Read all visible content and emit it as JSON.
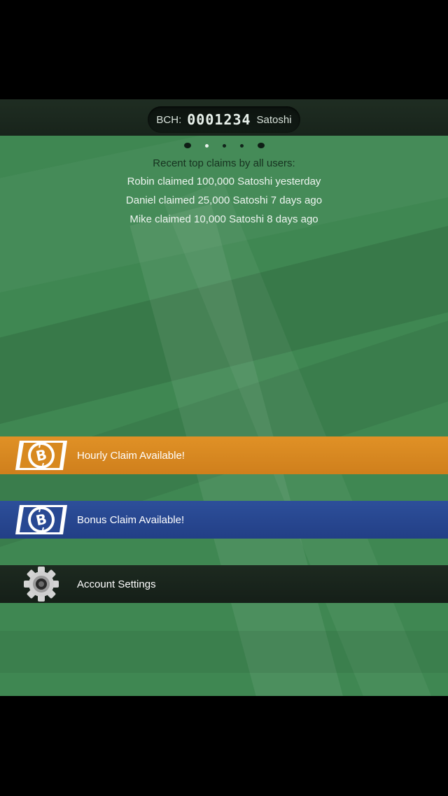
{
  "balance": {
    "label": "BCH:",
    "digits": "0001234",
    "unit": "Satoshi"
  },
  "pager": {
    "count": 5,
    "active_index": 1
  },
  "recent_claims": {
    "title": "Recent top claims by all users:",
    "items": [
      "Robin claimed 100,000 Satoshi yesterday",
      "Daniel claimed 25,000 Satoshi 7 days ago",
      "Mike claimed 10,000 Satoshi 8 days ago"
    ]
  },
  "menu": {
    "hourly_label": "Hourly Claim Available!",
    "bonus_label": "Bonus Claim Available!",
    "settings_label": "Account Settings"
  },
  "colors": {
    "background_green": "#3f8752",
    "hourly_orange": "#d8891f",
    "bonus_blue": "#284893",
    "settings_dark": "#1a261d"
  },
  "icons": {
    "hourly": "bitcoin-cash-coin-icon",
    "bonus": "bitcoin-cash-coin-icon",
    "settings": "gear-icon"
  }
}
